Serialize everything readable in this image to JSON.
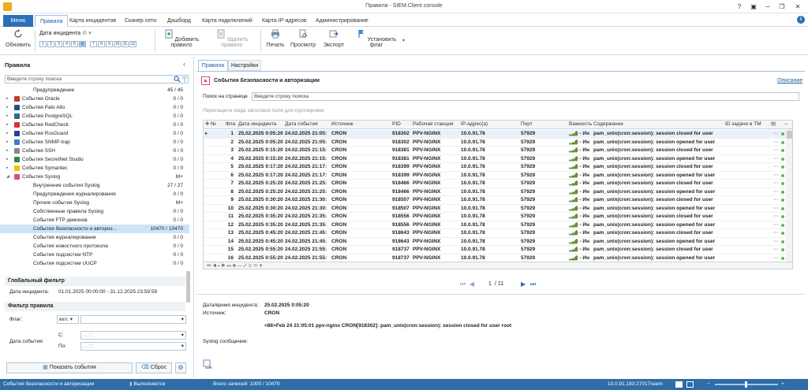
{
  "window": {
    "title": "Правила - SIEM.Client console"
  },
  "ribbon_tabs": [
    {
      "label": "Меню"
    },
    {
      "label": "Правила"
    },
    {
      "label": "Карта инцидентов"
    },
    {
      "label": "Сканер сети"
    },
    {
      "label": "Дашборд"
    },
    {
      "label": "Карта подключений"
    },
    {
      "label": "Карта IP-адресов"
    },
    {
      "label": "Администрирование"
    }
  ],
  "toolbar": {
    "refresh": "Обновить",
    "incident_date": "Дата инцидента",
    "date_boxes": [
      "1",
      "2",
      "3",
      "4",
      "5",
      "6",
      "7",
      "8",
      "9",
      "10",
      "11",
      "12"
    ],
    "add_rule": "Добавить правило",
    "delete_rule": "Удалить правило",
    "print": "Печать",
    "preview": "Просмотр",
    "export": "Экспорт",
    "set_flag": "Установить флаг"
  },
  "left": {
    "title": "Правила",
    "search_placeholder": "Введите строку поиска",
    "tree": [
      {
        "label": "Предупреждение",
        "count": "45 / 45",
        "indent": 2,
        "icon": ""
      },
      {
        "label": "События Oracle",
        "count": "0 / 0",
        "indent": 1,
        "icon": "#c0392b"
      },
      {
        "label": "События Palo Alto",
        "count": "0 / 0",
        "indent": 1,
        "icon": "#1f4f8b"
      },
      {
        "label": "События PostgreSQL",
        "count": "0 / 0",
        "indent": 1,
        "icon": "#336791"
      },
      {
        "label": "События RedCheck",
        "count": "0 / 0",
        "indent": 1,
        "icon": "#d9332b"
      },
      {
        "label": "События RusGuard",
        "count": "0 / 0",
        "indent": 1,
        "icon": "#2d3f8f"
      },
      {
        "label": "События SNMP-trap",
        "count": "0 / 0",
        "indent": 1,
        "icon": "#3e7cc1"
      },
      {
        "label": "События SSH",
        "count": "0 / 0",
        "indent": 1,
        "icon": "#888888"
      },
      {
        "label": "События SecretNet Studio",
        "count": "0 / 0",
        "indent": 1,
        "icon": "#2a8a3c"
      },
      {
        "label": "События Symantec",
        "count": "0 / 0",
        "indent": 1,
        "icon": "#f2c400"
      },
      {
        "label": "События Syslog",
        "count": "M+",
        "indent": 1,
        "icon": "#d84b8a"
      },
      {
        "label": "Внутренние события Syslog",
        "count": "27 / 27",
        "indent": 2,
        "icon": ""
      },
      {
        "label": "Предупреждения журналирования",
        "count": "0 / 0",
        "indent": 2,
        "icon": ""
      },
      {
        "label": "Прочие события Syslog",
        "count": "M+",
        "indent": 2,
        "icon": ""
      },
      {
        "label": "Собственные правила Syslog",
        "count": "0 / 0",
        "indent": 2,
        "icon": ""
      },
      {
        "label": "События FTP демонов",
        "count": "0 / 0",
        "indent": 2,
        "icon": ""
      },
      {
        "label": "События безопасности и авториз...",
        "count": "10470 / 10470",
        "indent": 2,
        "icon": "",
        "selected": true
      },
      {
        "label": "События журналирования",
        "count": "0 / 0",
        "indent": 2,
        "icon": ""
      },
      {
        "label": "События новостного протокола",
        "count": "0 / 0",
        "indent": 2,
        "icon": ""
      },
      {
        "label": "События подсистем NTP",
        "count": "0 / 0",
        "indent": 2,
        "icon": ""
      },
      {
        "label": "События подсистем UUCP",
        "count": "0 / 0",
        "indent": 2,
        "icon": ""
      }
    ],
    "global_filter": {
      "title": "Глобальный фильтр",
      "date_label": "Дата инцидента:",
      "date_value": "01.01.2025 00:00:00 - 31.12.2025 23:59:59"
    },
    "rule_filter": {
      "title": "Фильтр правила",
      "flag_label": "Флаг:",
      "flag_value": "вкл.",
      "date_label": "Дата события:",
      "from_label": "С:",
      "to_label": "По:",
      "date_mask": ". .   : :",
      "show_button": "Показать события",
      "reset_button": "Сброс"
    }
  },
  "right": {
    "tabs": [
      "Правила",
      "Настройки"
    ],
    "header": "События безопасности и авторизации",
    "description_link": "Описание",
    "page_search_label": "Поиск на странице",
    "page_search_placeholder": "Введите строку поиска",
    "group_hint": "Перетащите сюда заголовок поля для группировки",
    "columns": [
      "№",
      "Фла",
      "Дата инцидента",
      "Дата события",
      "Источник",
      "PID",
      "Рабочая станция",
      "IP-адрес(а)",
      "Порт",
      "Важность",
      "Содержание",
      "ID задачи в ТМ"
    ],
    "rows": [
      [
        "1",
        "25.02.2025 0:05:20",
        "24.02.2025 21:05:",
        "CRON",
        "918302",
        "PPV-NGINX",
        "10.0.91.78",
        "57929",
        "6 - Ин",
        "pam_unix(cron:session): session closed for user"
      ],
      [
        "2",
        "25.02.2025 0:05:20",
        "24.02.2025 21:05:",
        "CRON",
        "918302",
        "PPV-NGINX",
        "10.0.91.78",
        "57929",
        "6 - Ин",
        "pam_unix(cron:session): session opened for user"
      ],
      [
        "3",
        "25.02.2025 0:15:20",
        "24.02.2025 21:15:",
        "CRON",
        "918381",
        "PPV-NGINX",
        "10.0.91.78",
        "57929",
        "6 - Ин",
        "pam_unix(cron:session): session closed for user"
      ],
      [
        "4",
        "25.02.2025 0:15:20",
        "24.02.2025 21:15:",
        "CRON",
        "918381",
        "PPV-NGINX",
        "10.0.91.78",
        "57929",
        "6 - Ин",
        "pam_unix(cron:session): session opened for user"
      ],
      [
        "5",
        "25.02.2025 0:17:20",
        "24.02.2025 21:17:",
        "CRON",
        "918399",
        "PPV-NGINX",
        "10.0.91.78",
        "57929",
        "6 - Ин",
        "pam_unix(cron:session): session closed for user"
      ],
      [
        "6",
        "25.02.2025 0:17:20",
        "24.02.2025 21:17:",
        "CRON",
        "918399",
        "PPV-NGINX",
        "10.0.91.78",
        "57929",
        "6 - Ин",
        "pam_unix(cron:session): session opened for user"
      ],
      [
        "7",
        "25.02.2025 0:25:20",
        "24.02.2025 21:25:",
        "CRON",
        "918466",
        "PPV-NGINX",
        "10.0.91.78",
        "57929",
        "6 - Ин",
        "pam_unix(cron:session): session closed for user"
      ],
      [
        "8",
        "25.02.2025 0:25:20",
        "24.02.2025 21:25:",
        "CRON",
        "918466",
        "PPV-NGINX",
        "10.0.91.78",
        "57929",
        "6 - Ин",
        "pam_unix(cron:session): session opened for user"
      ],
      [
        "9",
        "25.02.2025 0:30:20",
        "24.02.2025 21:30:",
        "CRON",
        "918507",
        "PPV-NGINX",
        "10.0.91.78",
        "57929",
        "6 - Ин",
        "pam_unix(cron:session): session closed for user"
      ],
      [
        "10",
        "25.02.2025 0:30:20",
        "24.02.2025 21:30:",
        "CRON",
        "918507",
        "PPV-NGINX",
        "10.0.91.78",
        "57929",
        "6 - Ин",
        "pam_unix(cron:session): session opened for user"
      ],
      [
        "11",
        "25.02.2025 0:35:20",
        "24.02.2025 21:35:",
        "CRON",
        "918556",
        "PPV-NGINX",
        "10.0.91.78",
        "57929",
        "6 - Ин",
        "pam_unix(cron:session): session closed for user"
      ],
      [
        "12",
        "25.02.2025 0:35:20",
        "24.02.2025 21:35:",
        "CRON",
        "918556",
        "PPV-NGINX",
        "10.0.91.78",
        "57929",
        "6 - Ин",
        "pam_unix(cron:session): session opened for user"
      ],
      [
        "13",
        "25.02.2025 0:45:20",
        "24.02.2025 21:45:",
        "CRON",
        "918643",
        "PPV-NGINX",
        "10.0.91.78",
        "57929",
        "6 - Ин",
        "pam_unix(cron:session): session closed for user"
      ],
      [
        "14",
        "25.02.2025 0:45:20",
        "24.02.2025 21:45:",
        "CRON",
        "918643",
        "PPV-NGINX",
        "10.0.91.78",
        "57929",
        "6 - Ин",
        "pam_unix(cron:session): session opened for user"
      ],
      [
        "15",
        "25.02.2025 0:55:20",
        "24.02.2025 21:55:",
        "CRON",
        "918737",
        "PPV-NGINX",
        "10.0.91.78",
        "57929",
        "6 - Ин",
        "pam_unix(cron:session): session closed for user"
      ],
      [
        "16",
        "25.02.2025 0:55:20",
        "24.02.2025 21:55:",
        "CRON",
        "918737",
        "PPV-NGINX",
        "10.0.91.78",
        "57929",
        "6 - Ин",
        "pam_unix(cron:session): session opened for user"
      ]
    ],
    "pager": {
      "current": "1",
      "total": "/ 11"
    },
    "detail": {
      "date_label": "Дата/время инцидента:",
      "date_value": "25.02.2025 0:05:20",
      "source_label": "Источник:",
      "source_value": "CRON",
      "message": "<86>Feb 24 21:05:01 ppv-nginx CRON[918302]: pam_unix(cron:session): session closed for user root",
      "syslog_label": "Syslog сообщение:"
    }
  },
  "status": {
    "left": "События безопасности и авторизации",
    "middle": "Выполняется",
    "records": "Всего записей: 1000 / 10470",
    "connection": "10.0.91.193:27017\\siem"
  },
  "colors": {
    "accent": "#2a6fb7",
    "selection": "#cde3f7",
    "status_bar": "#2f6ca8"
  }
}
